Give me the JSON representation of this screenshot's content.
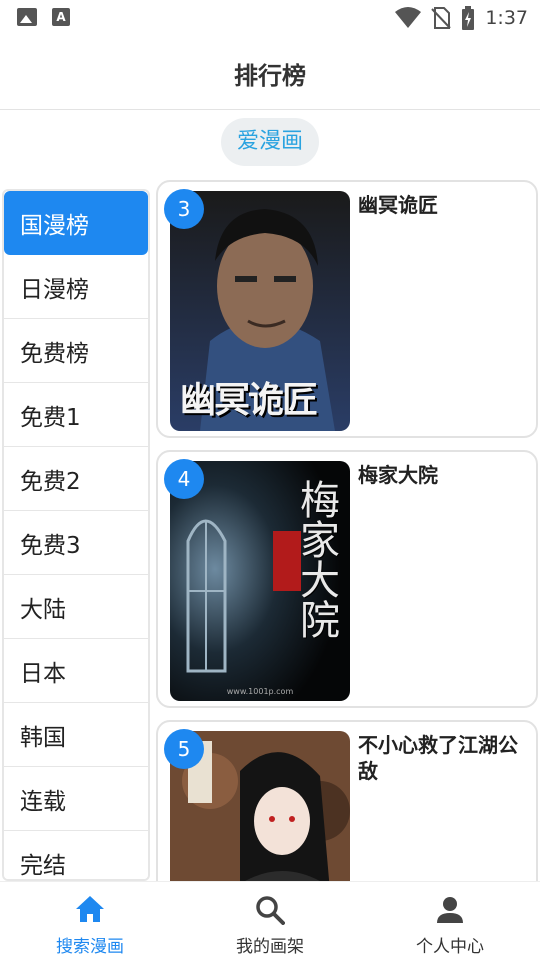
{
  "status_bar": {
    "time": "1:37",
    "icons": [
      "image-icon",
      "text-a-icon",
      "wifi-icon",
      "no-sim-icon",
      "battery-charging-icon"
    ]
  },
  "header": {
    "title": "排行榜"
  },
  "source_chip": {
    "label": "爱漫画"
  },
  "sidebar": {
    "items": [
      {
        "label": "国漫榜",
        "active": true
      },
      {
        "label": "日漫榜",
        "active": false
      },
      {
        "label": "免费榜",
        "active": false
      },
      {
        "label": "免费1",
        "active": false
      },
      {
        "label": "免费2",
        "active": false
      },
      {
        "label": "免费3",
        "active": false
      },
      {
        "label": "大陆",
        "active": false
      },
      {
        "label": "日本",
        "active": false
      },
      {
        "label": "韩国",
        "active": false
      },
      {
        "label": "连载",
        "active": false
      },
      {
        "label": "完结",
        "active": false
      }
    ]
  },
  "list": {
    "items": [
      {
        "rank": "3",
        "title": "幽冥诡匠",
        "cover_text": "幽冥诡匠"
      },
      {
        "rank": "4",
        "title": "梅家大院",
        "cover_text": "梅家大院",
        "cover_subtext": "www.1001p.com"
      },
      {
        "rank": "5",
        "title": "不小心救了江湖公敌",
        "cover_text": ""
      }
    ]
  },
  "bottom_nav": {
    "items": [
      {
        "label": "搜索漫画",
        "icon": "home-icon",
        "active": true
      },
      {
        "label": "我的画架",
        "icon": "search-icon",
        "active": false
      },
      {
        "label": "个人中心",
        "icon": "person-icon",
        "active": false
      }
    ]
  },
  "colors": {
    "accent": "#1e88f0",
    "chip_text": "#2aa3e0",
    "chip_bg": "#eceff1"
  }
}
